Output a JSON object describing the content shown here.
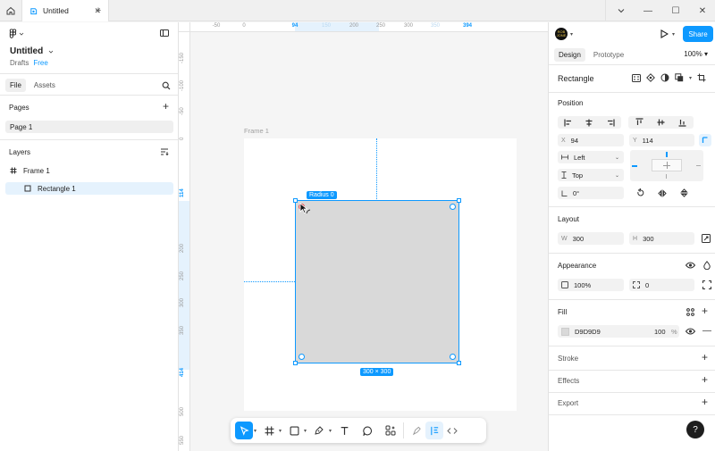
{
  "titlebar": {
    "tab_label": "Untitled",
    "tab_close": "✕",
    "new_tab": "+",
    "minimize": "—",
    "maximize": "☐",
    "close": "✕"
  },
  "left_panel": {
    "file_name": "Untitled",
    "location": "Drafts",
    "plan": "Free",
    "tabs": [
      "File",
      "Assets"
    ],
    "pages_title": "Pages",
    "pages": [
      "Page 1"
    ],
    "layers_title": "Layers",
    "layers": [
      {
        "name": "Frame 1",
        "type": "frame"
      },
      {
        "name": "Rectangle 1",
        "type": "rectangle",
        "selected": true
      }
    ]
  },
  "rulers": {
    "top": [
      "-50",
      "0",
      "94",
      "150",
      "200",
      "250",
      "300",
      "350",
      "394"
    ],
    "top_highlight": [
      "94",
      "394"
    ],
    "left": [
      "-150",
      "-100",
      "-50",
      "0",
      "114",
      "200",
      "250",
      "300",
      "350",
      "414",
      "500",
      "550"
    ],
    "left_highlight": [
      "114",
      "414"
    ]
  },
  "canvas": {
    "frame_label": "Frame 1",
    "radius_badge": "Radius 0",
    "size_badge": "300 × 300",
    "rect_fill": "#D9D9D9",
    "selection_color": "#0D99FF"
  },
  "toolbar": {
    "tools": [
      "move-tool",
      "frame-tool",
      "shape-tool",
      "pen-tool",
      "text-tool",
      "comment-tool",
      "actions-tool"
    ],
    "modes": [
      "draw-mode",
      "design-mode",
      "dev-mode"
    ]
  },
  "right_panel": {
    "avatar_text": "ROB\nJONE",
    "share_label": "Share",
    "tabs": [
      "Design",
      "Prototype"
    ],
    "zoom": "100%",
    "node_title": "Rectangle",
    "position_title": "Position",
    "x_label": "X",
    "x_value": "94",
    "y_label": "Y",
    "y_value": "114",
    "h_constraint": "Left",
    "v_constraint": "Top",
    "rotation": "0°",
    "layout_title": "Layout",
    "w_label": "W",
    "w_value": "300",
    "h_label": "H",
    "h_value": "300",
    "appearance_title": "Appearance",
    "opacity": "100%",
    "corner_radius": "0",
    "fill_title": "Fill",
    "fill_hex": "D9D9D9",
    "fill_opacity": "100",
    "fill_percent": "%",
    "stroke_title": "Stroke",
    "effects_title": "Effects",
    "export_title": "Export",
    "help": "?"
  }
}
